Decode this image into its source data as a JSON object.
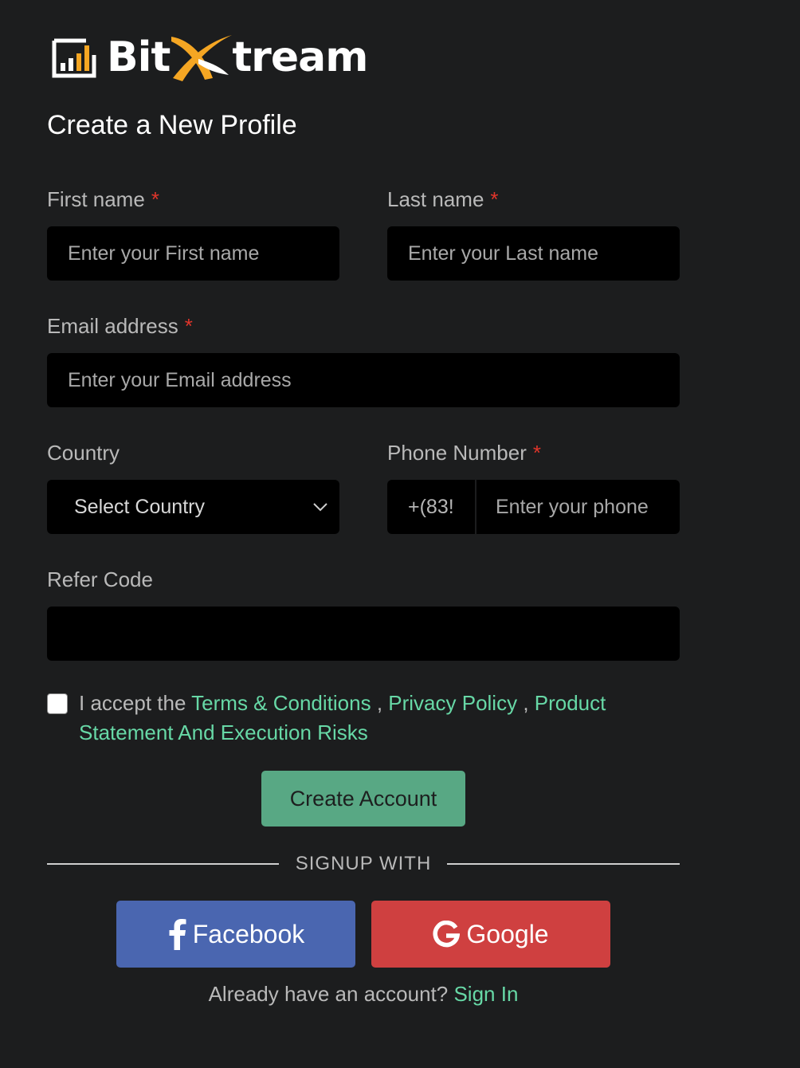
{
  "brand": {
    "name_part1": "Bit",
    "name_part2": "tream",
    "accent": "#f5a623"
  },
  "page_title": "Create a New Profile",
  "form": {
    "first_name": {
      "label": "First name",
      "required_mark": "*",
      "placeholder": "Enter your First name"
    },
    "last_name": {
      "label": "Last name",
      "required_mark": "*",
      "placeholder": "Enter your Last name"
    },
    "email": {
      "label": "Email address",
      "required_mark": "*",
      "placeholder": "Enter your Email address"
    },
    "country": {
      "label": "Country",
      "selected": "Select Country"
    },
    "phone": {
      "label": "Phone Number",
      "required_mark": "*",
      "code": "+(83!",
      "placeholder": "Enter your phone"
    },
    "refer_code": {
      "label": "Refer Code",
      "value": ""
    }
  },
  "terms": {
    "prefix": "I accept the ",
    "terms_link": "Terms & Conditions",
    "sep1": " , ",
    "privacy_link": "Privacy Policy",
    "sep2": " , ",
    "product_link": "Product Statement And Execution Risks"
  },
  "create_button": "Create Account",
  "divider_text": "SIGNUP WITH",
  "social": {
    "facebook": "Facebook",
    "google": "Google"
  },
  "signin": {
    "prompt": "Already have an account? ",
    "link": "Sign In"
  },
  "colors": {
    "background": "#1c1d1e",
    "link": "#67d8a6",
    "button": "#58a884",
    "facebook": "#4a66b0",
    "google": "#cf4040",
    "required": "#e0352b"
  }
}
